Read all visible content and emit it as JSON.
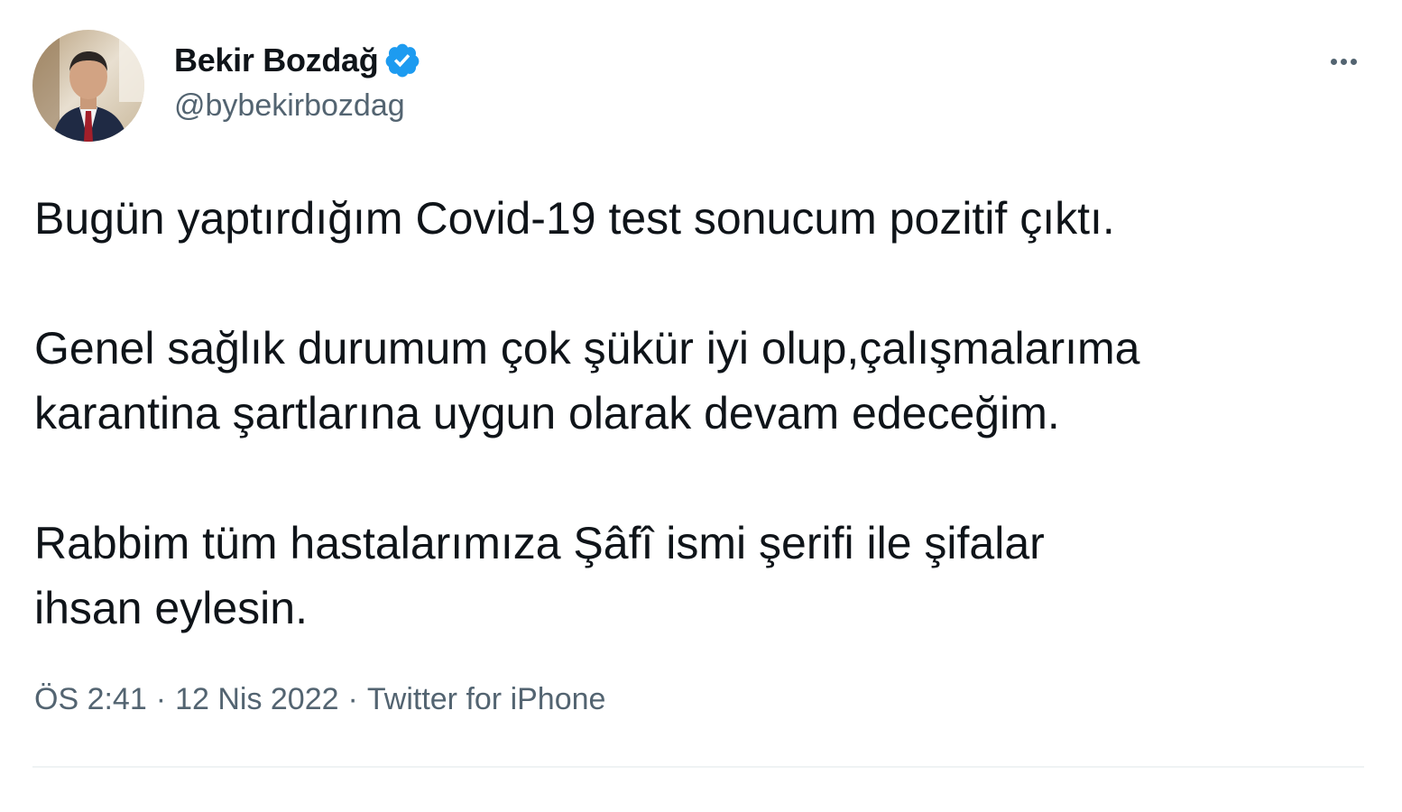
{
  "author": {
    "display_name": "Bekir Bozdağ",
    "handle": "@bybekirbozdag",
    "verified": true,
    "verified_color": "#1d9bf0"
  },
  "tweet": {
    "paragraphs": [
      [
        "Bugün yaptırdığım Covid-19 test sonucum pozitif çıktı."
      ],
      [
        "Genel sağlık durumum çok şükür iyi olup,çalışmalarıma",
        "karantina şartlarına uygun olarak devam edeceğim."
      ],
      [
        "Rabbim tüm hastalarımıza Şâfî ismi şerifi ile şifalar",
        "ihsan eylesin."
      ]
    ],
    "time": "ÖS 2:41",
    "date": "12 Nis 2022",
    "source": "Twitter for iPhone",
    "separator": "·"
  },
  "icons": {
    "more": "more-horizontal-icon",
    "verified": "verified-badge-icon"
  },
  "colors": {
    "text": "#0f1419",
    "secondary": "#536471",
    "divider": "#eff3f4"
  }
}
